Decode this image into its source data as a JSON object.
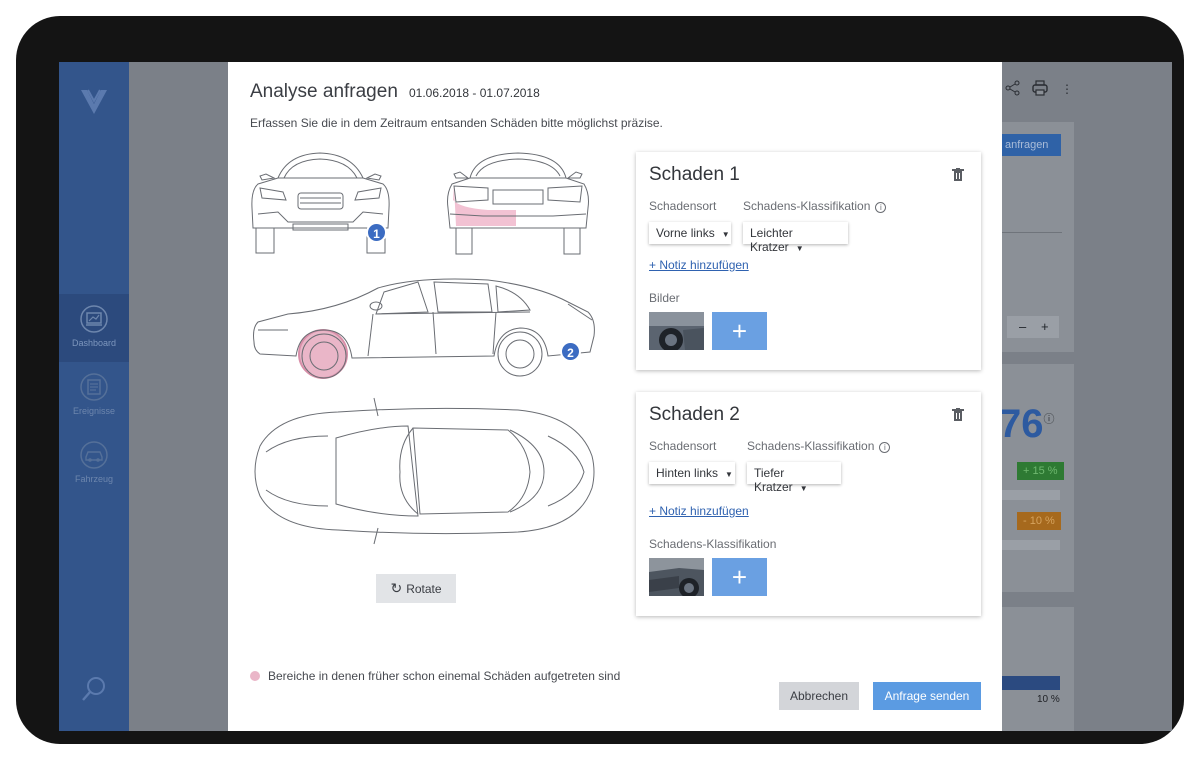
{
  "sidebar": {
    "logo": "V",
    "items": [
      {
        "label": "Dashboard",
        "icon": "dashboard-icon",
        "active": true
      },
      {
        "label": "Ereignisse",
        "icon": "events-icon",
        "active": false
      },
      {
        "label": "Fahrzeug",
        "icon": "car-icon",
        "active": false
      }
    ]
  },
  "background": {
    "request_btn": "anfragen",
    "stepper_minus": "–",
    "stepper_plus": "+",
    "big_value": "76",
    "big_info": "ⓘ",
    "badge_up": "+ 15 %",
    "badge_down": "- 10 %",
    "bar_pct": "10 %"
  },
  "modal": {
    "title": "Analyse anfragen",
    "dates": "01.06.2018 - 01.07.2018",
    "subtitle": "Erfassen Sie die in dem Zeitraum entsanden Schäden bitte möglichst präzise.",
    "marker_1": "1",
    "marker_2": "2",
    "rotate_label": "Rotate",
    "legend_text": "Bereiche in denen früher schon einemal Schäden aufgetreten sind",
    "cancel_label": "Abbrechen",
    "send_label": "Anfrage senden",
    "damages": [
      {
        "title": "Schaden 1",
        "type_label": "Schadensort",
        "class_label": "Schadens-Klassifikation",
        "type_value": "Vorne links",
        "class_value": "Leichter Kratzer",
        "note_link": "+ Notiz hinzufügen",
        "images_label": "Bilder",
        "add_label": "+"
      },
      {
        "title": "Schaden 2",
        "type_label": "Schadensort",
        "class_label": "Schadens-Klassifikation",
        "type_value": "Hinten links",
        "class_value": "Tiefer Kratzer",
        "note_link": "+ Notiz hinzufügen",
        "images_label": "Schadens-Klassifikation",
        "add_label": "+"
      }
    ]
  },
  "colors": {
    "accent": "#5b9be2",
    "sidebar": "#33558b",
    "damage_highlight": "#eab6c8",
    "marker": "#3c6cc2"
  }
}
